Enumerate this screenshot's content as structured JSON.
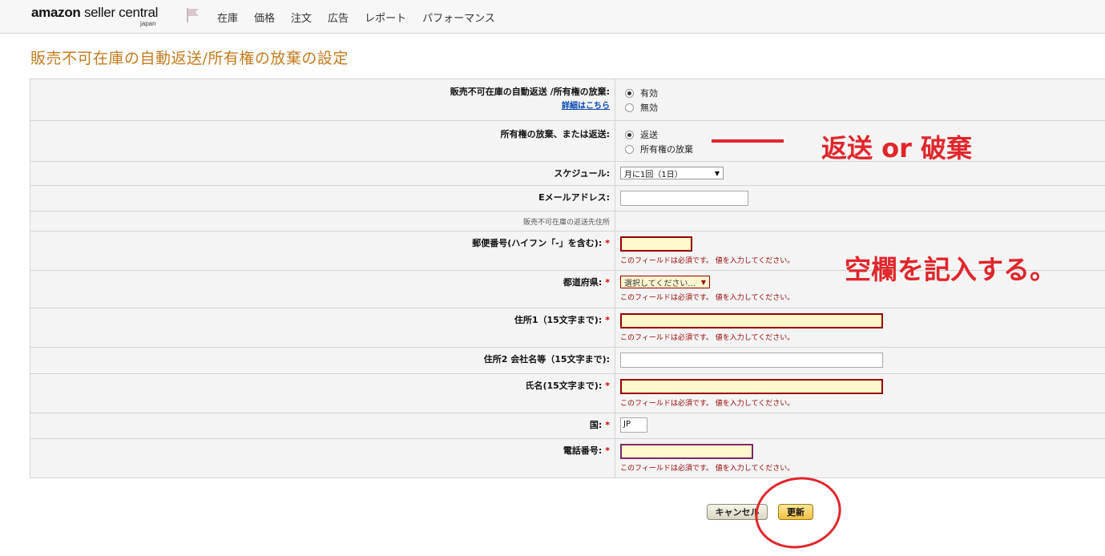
{
  "header": {
    "logo_brand": "amazon",
    "logo_product": "seller central",
    "logo_region": "japan",
    "nav": [
      "在庫",
      "価格",
      "注文",
      "広告",
      "レポート",
      "パフォーマンス"
    ]
  },
  "page": {
    "title": "販売不可在庫の自動返送/所有権の放棄の設定"
  },
  "form": {
    "auto_setting": {
      "label": "販売不可在庫の自動返送 /所有権の放棄:",
      "details_link": "詳細はこちら",
      "options": [
        "有効",
        "無効"
      ],
      "selected": "有効"
    },
    "action": {
      "label": "所有権の放棄、または返送:",
      "options": [
        "返送",
        "所有権の放棄"
      ],
      "selected": "返送"
    },
    "schedule": {
      "label": "スケジュール:",
      "value": "月に1回（1日）"
    },
    "email": {
      "label": "Eメールアドレス:",
      "value": ""
    },
    "address_section": {
      "label": "販売不可在庫の返送先住所"
    },
    "postal": {
      "label": "郵便番号(ハイフン「-」を含む):",
      "value": "",
      "required": true
    },
    "prefecture": {
      "label": "都道府県:",
      "value": "選択してください...",
      "required": true
    },
    "address1": {
      "label": "住所1（15文字まで):",
      "value": "",
      "required": true
    },
    "address2": {
      "label": "住所2 会社名等（15文字まで):",
      "value": "",
      "required": false
    },
    "name": {
      "label": "氏名(15文字まで):",
      "value": "",
      "required": true
    },
    "country": {
      "label": "国:",
      "value": "JP",
      "required": true
    },
    "phone": {
      "label": "電話番号:",
      "value": "",
      "required": true
    },
    "required_mark": "*",
    "error_message": "このフィールドは必須です。 値を入力してください。"
  },
  "buttons": {
    "cancel": "キャンセル",
    "update": "更新"
  },
  "annotations": {
    "action_note": "返送 or 破棄",
    "fill_note": "空欄を記入する。",
    "color": "#e0262b"
  },
  "colors": {
    "title": "#c27a1c",
    "error": "#990000",
    "update_button": "#f0c141"
  }
}
